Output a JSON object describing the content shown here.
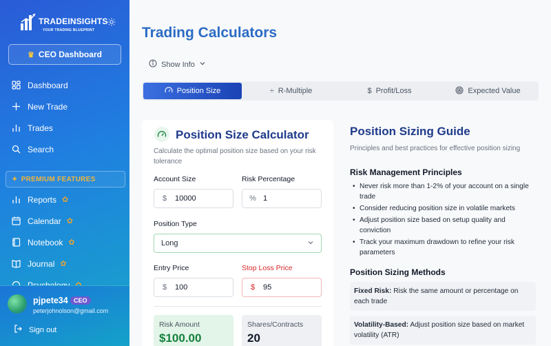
{
  "brand": {
    "title": "TRADEINSIGHTS",
    "subtitle": "YOUR TRADING BLUEPRINT"
  },
  "sidebar": {
    "ceo_button": "CEO Dashboard",
    "items": [
      {
        "label": "Dashboard",
        "icon": "grid-icon"
      },
      {
        "label": "New Trade",
        "icon": "plus-icon"
      },
      {
        "label": "Trades",
        "icon": "bar-chart-icon"
      },
      {
        "label": "Search",
        "icon": "search-icon"
      }
    ],
    "premium_label": "PREMIUM FEATURES",
    "premium_items": [
      {
        "label": "Reports",
        "icon": "bar-chart-icon"
      },
      {
        "label": "Calendar",
        "icon": "calendar-icon"
      },
      {
        "label": "Notebook",
        "icon": "notebook-icon"
      },
      {
        "label": "Journal",
        "icon": "book-icon"
      },
      {
        "label": "Psychology",
        "icon": "brain-icon"
      }
    ]
  },
  "user": {
    "name": "pjpete34",
    "badge": "CEO",
    "email": "peterjohnolson@gmail.com",
    "signout": "Sign out"
  },
  "page": {
    "title": "Trading Calculators",
    "show_info": "Show Info",
    "tabs": [
      {
        "label": "Position Size",
        "icon": "gauge-icon",
        "active": true
      },
      {
        "label": "R-Multiple",
        "icon": "divide-icon",
        "active": false
      },
      {
        "label": "Profit/Loss",
        "icon": "dollar-icon",
        "active": false
      },
      {
        "label": "Expected Value",
        "icon": "target-icon",
        "active": false
      }
    ]
  },
  "calculator": {
    "title": "Position Size Calculator",
    "description": "Calculate the optimal position size based on your risk tolerance",
    "account_size_label": "Account Size",
    "account_size_prefix": "$",
    "account_size_value": "10000",
    "risk_pct_label": "Risk Percentage",
    "risk_pct_prefix": "%",
    "risk_pct_value": "1",
    "position_type_label": "Position Type",
    "position_type_value": "Long",
    "entry_label": "Entry Price",
    "entry_prefix": "$",
    "entry_value": "100",
    "stop_label": "Stop Loss Price",
    "stop_prefix": "$",
    "stop_value": "95",
    "risk_amount_label": "Risk Amount",
    "risk_amount_value": "$100.00",
    "shares_label": "Shares/Contracts",
    "shares_value": "20"
  },
  "guide": {
    "title": "Position Sizing Guide",
    "subtitle": "Principles and best practices for effective position sizing",
    "principles_heading": "Risk Management Principles",
    "principles": [
      "Never risk more than 1-2% of your account on a single trade",
      "Consider reducing position size in volatile markets",
      "Adjust position size based on setup quality and conviction",
      "Track your maximum drawdown to refine your risk parameters"
    ],
    "methods_heading": "Position Sizing Methods",
    "methods": [
      {
        "name": "Fixed Risk:",
        "text": "Risk the same amount or percentage on each trade"
      },
      {
        "name": "Volatility-Based:",
        "text": "Adjust position size based on market volatility (ATR)"
      }
    ]
  },
  "colors": {
    "accent": "#2b6bc4",
    "active_tab": "#2a55c9",
    "success": "#15803d",
    "danger": "#dc2626"
  }
}
